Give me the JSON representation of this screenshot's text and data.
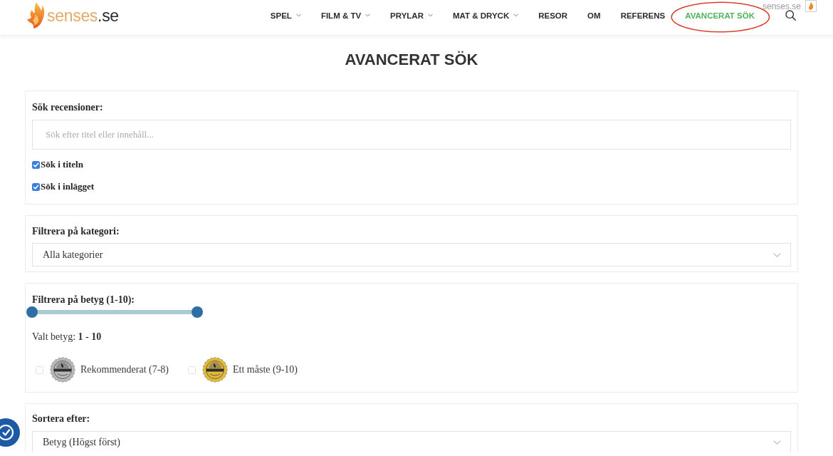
{
  "header": {
    "logo": {
      "name": "senses",
      "suffix": ".se"
    },
    "nav": [
      {
        "label": "SPEL",
        "has_menu": true,
        "selected": false,
        "circled": false
      },
      {
        "label": "FILM & TV",
        "has_menu": true,
        "selected": false,
        "circled": false
      },
      {
        "label": "PRYLAR",
        "has_menu": true,
        "selected": false,
        "circled": false
      },
      {
        "label": "MAT & DRYCK",
        "has_menu": true,
        "selected": false,
        "circled": false
      },
      {
        "label": "RESOR",
        "has_menu": false,
        "selected": false,
        "circled": false
      },
      {
        "label": "OM",
        "has_menu": false,
        "selected": false,
        "circled": false
      },
      {
        "label": "REFERENS",
        "has_menu": false,
        "selected": false,
        "circled": false
      },
      {
        "label": "AVANCERAT SÖK",
        "has_menu": false,
        "selected": true,
        "circled": true
      }
    ],
    "corner_image": {
      "alt": "senses.se"
    }
  },
  "page_title": "AVANCERAT SÖK",
  "search_section": {
    "label": "Sök recensioner:",
    "search": {
      "placeholder": "Sök efter titel eller innehåll..."
    },
    "options": [
      {
        "label": "Sök i titeln",
        "checked": true
      },
      {
        "label": "Sök i inlägget",
        "checked": true
      }
    ]
  },
  "category_section": {
    "label": "Filtrera på kategori:",
    "select": {
      "value": "Alla kategorier"
    }
  },
  "rating_section": {
    "label": "Filtrera på betyg (1-10):",
    "slider": {
      "handles": [
        {
          "level": 0
        },
        {
          "level": 1
        }
      ]
    },
    "selected_text": "Valt betyg: **1 - 10**",
    "badges": [
      {
        "label": "Rekommenderat (7-8)",
        "checked": false,
        "color": "#b8b8b8"
      },
      {
        "label": "Ett måste (9-10)",
        "checked": false,
        "color": "#e3b935"
      }
    ]
  },
  "sort_section": {
    "label": "Sortera efter:",
    "select": {
      "value": "Betyg (Högst först)"
    }
  }
}
